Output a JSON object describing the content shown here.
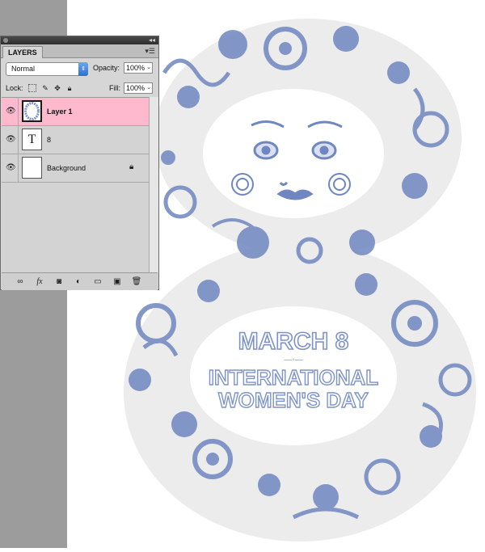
{
  "panel": {
    "tab_label": "LAYERS",
    "menu_icon": "panel-menu-icon",
    "collapse_label": "◂◂",
    "blend_mode": "Normal",
    "opacity_label": "Opacity:",
    "opacity_value": "100%",
    "lock_label": "Lock:",
    "fill_label": "Fill:",
    "fill_value": "100%",
    "layers": [
      {
        "name": "Layer 1",
        "selected": true,
        "thumb": "pattern"
      },
      {
        "name": "8",
        "selected": false,
        "thumb": "type",
        "thumb_glyph": "T"
      },
      {
        "name": "Background",
        "selected": false,
        "thumb": "white",
        "locked": true
      }
    ],
    "bottom_icons": [
      "link-layers-icon",
      "fx-icon",
      "add-mask-icon",
      "adjustment-layer-icon",
      "new-group-icon",
      "new-layer-icon",
      "delete-layer-icon"
    ]
  },
  "canvas": {
    "line1": "MARCH 8",
    "line2": "INTERNATIONAL",
    "line3": "WOMEN'S DAY"
  },
  "colors": {
    "ornament": "#6f86c0",
    "figure_bg": "#ececec",
    "selected_layer": "#ffb9cf"
  }
}
